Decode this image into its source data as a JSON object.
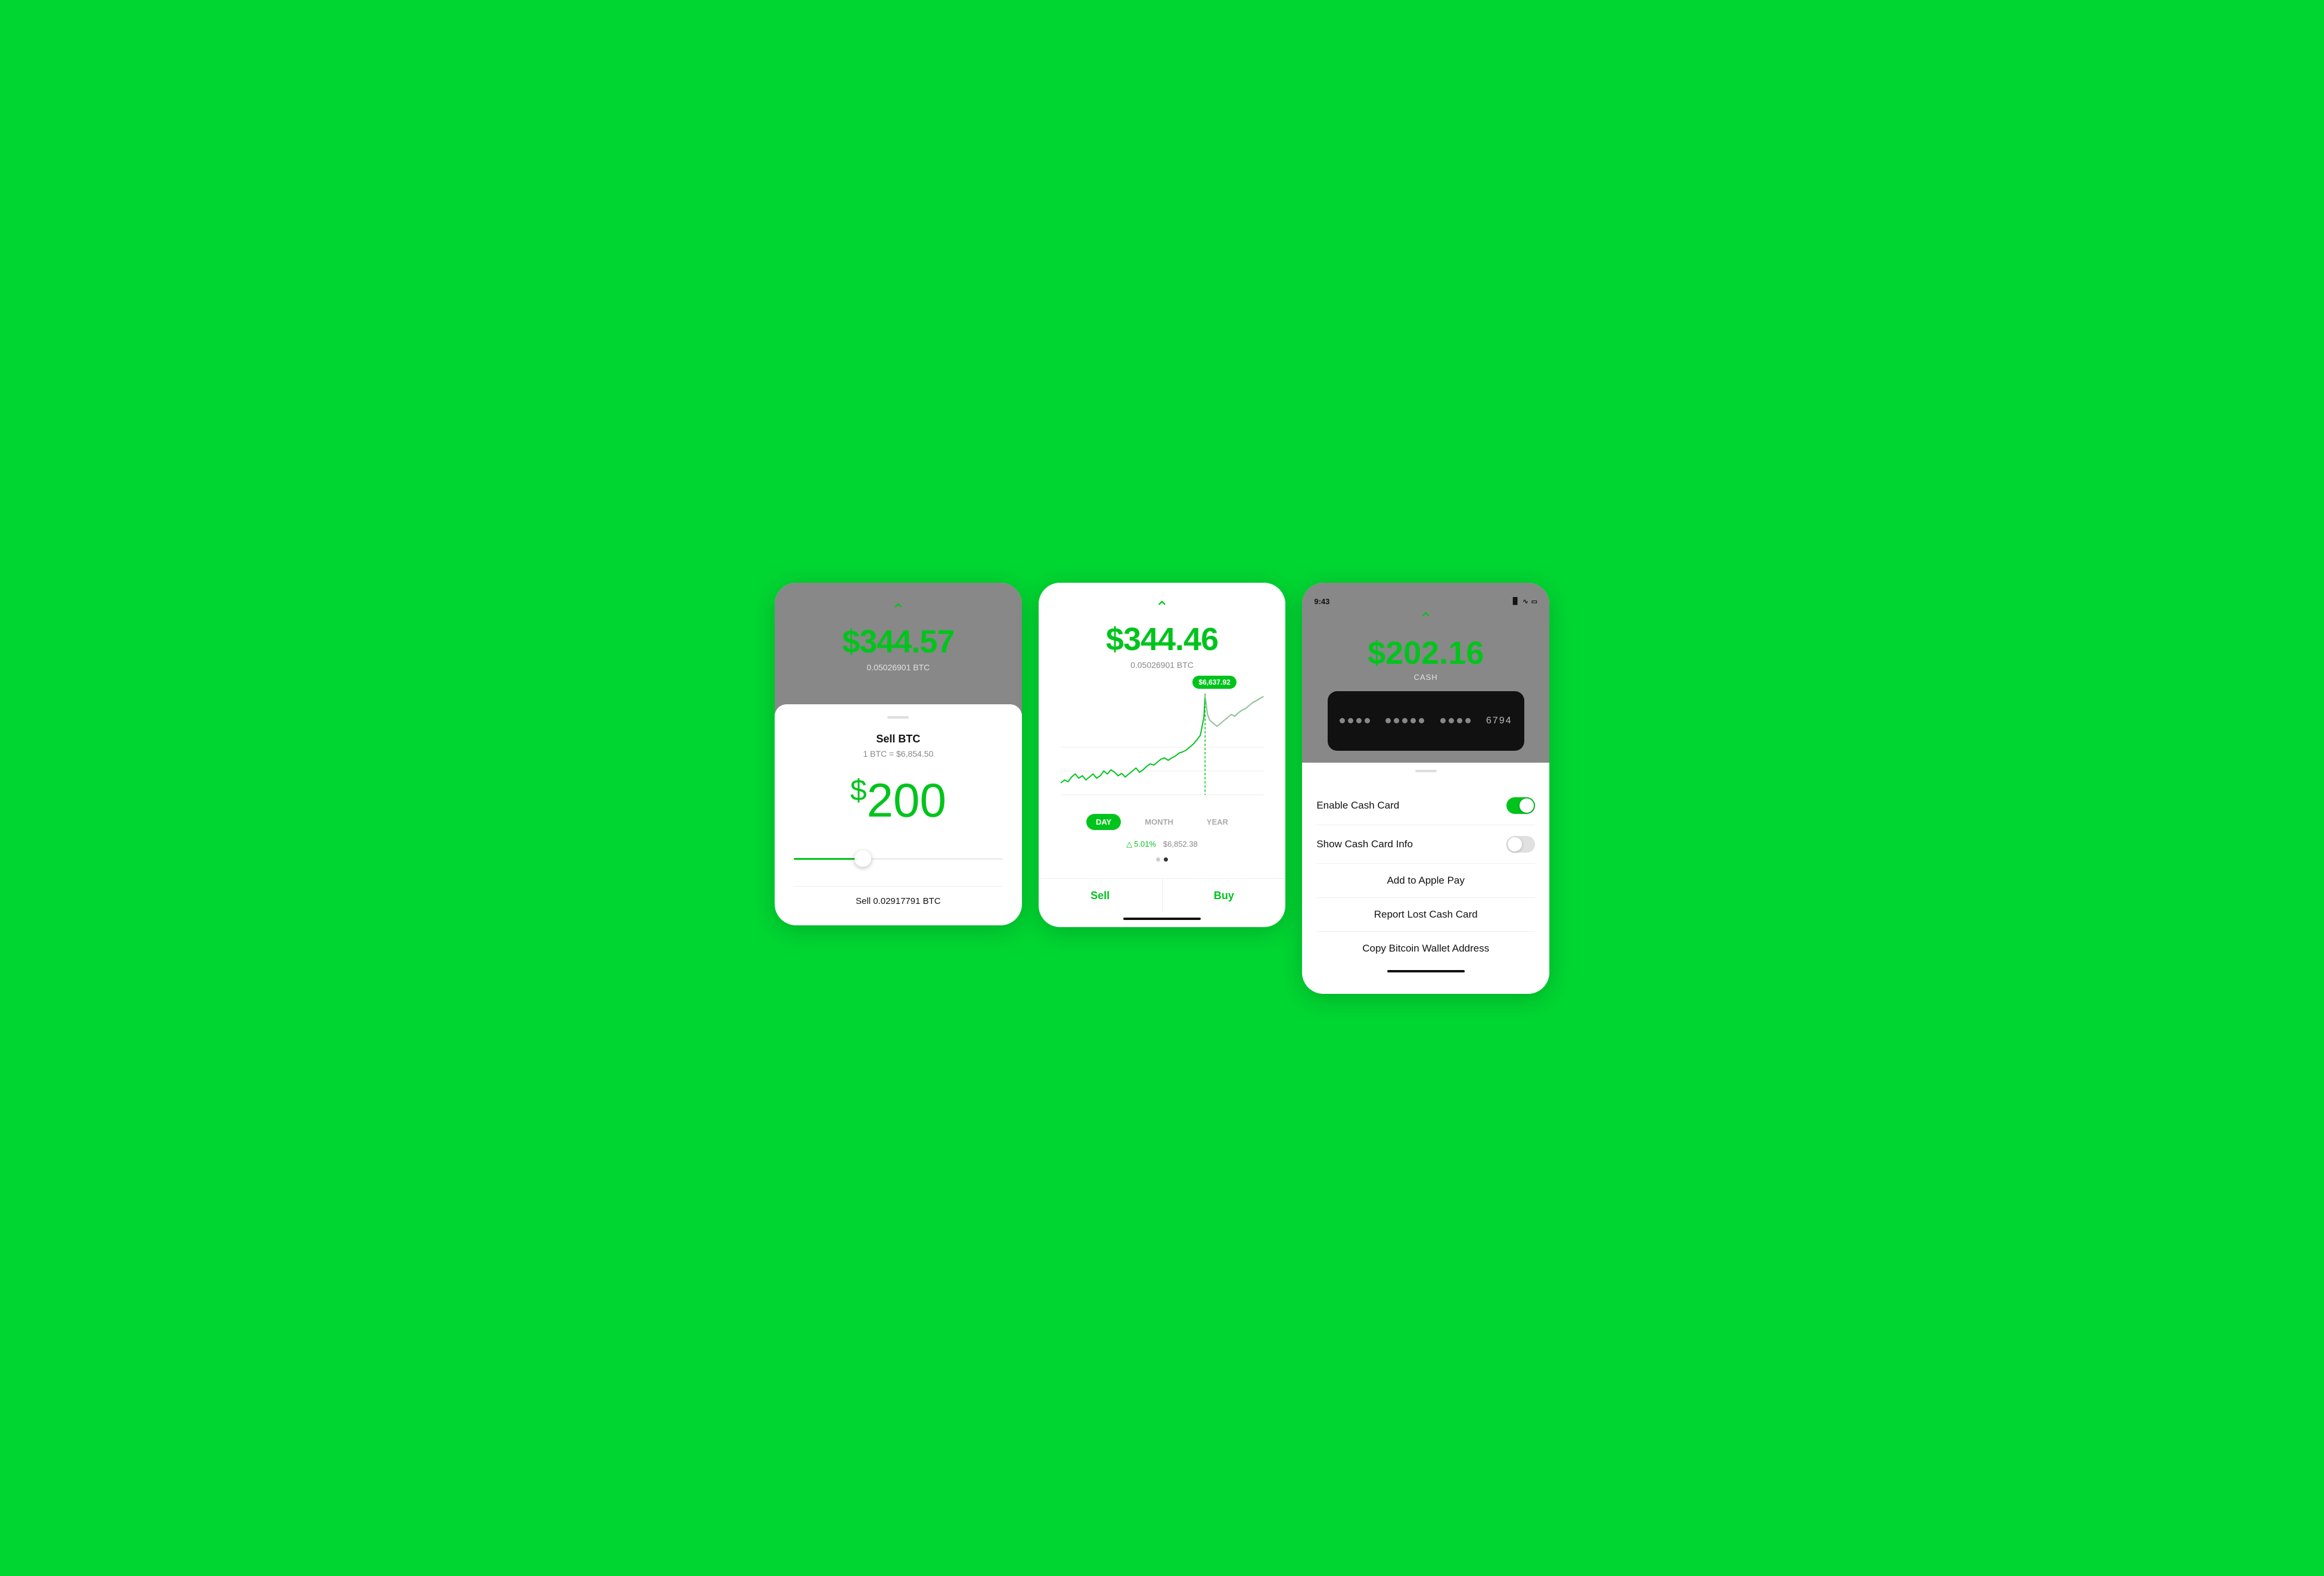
{
  "background_color": "#00D632",
  "screens": {
    "screen1": {
      "top": {
        "main_amount": "$344.57",
        "btc_sub": "0.05026901 BTC"
      },
      "bottom": {
        "title": "Sell BTC",
        "rate": "1 BTC = $6,854.50",
        "amount_dollar": "$",
        "amount_value": "200",
        "sell_label": "Sell 0.02917791 BTC"
      }
    },
    "screen2": {
      "top": {
        "main_amount": "$344.46",
        "btc_sub": "0.05026901 BTC",
        "chart_bubble": "$6,637.92"
      },
      "time_options": [
        "DAY",
        "MONTH",
        "YEAR"
      ],
      "active_time": "DAY",
      "stats": {
        "pct": "5.01%",
        "price": "$6,852.38"
      },
      "actions": {
        "sell": "Sell",
        "buy": "Buy"
      }
    },
    "screen3": {
      "status_bar": {
        "time": "9:43",
        "location": "✈",
        "signal": "▐▐",
        "wifi": "wifi",
        "battery": "battery"
      },
      "top": {
        "main_amount": "$202.16",
        "cash_label": "CASH"
      },
      "card": {
        "number": "6794"
      },
      "menu": {
        "enable_cash_card": "Enable Cash Card",
        "show_cash_card_info": "Show Cash Card Info",
        "add_to_apple_pay": "Add to Apple Pay",
        "report_lost_card": "Report Lost Cash Card",
        "copy_bitcoin": "Copy Bitcoin Wallet Address"
      },
      "toggles": {
        "enable": true,
        "show_info": false
      }
    }
  },
  "icons": {
    "chevron_up": "^",
    "arrow_up": "↑",
    "circle_up": "⬆"
  }
}
